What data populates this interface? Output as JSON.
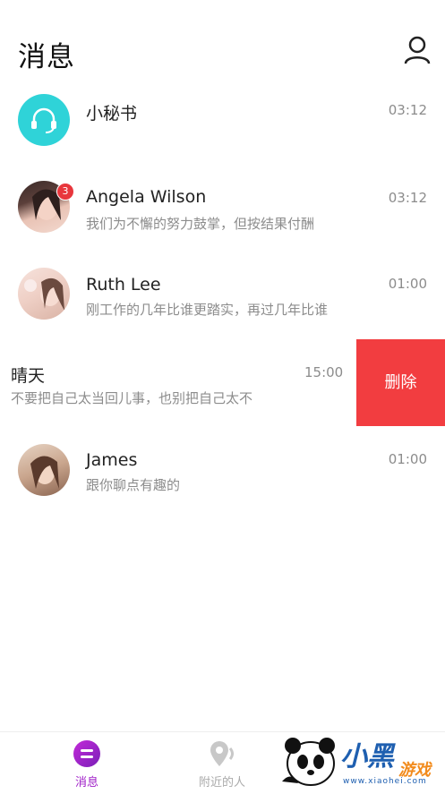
{
  "header": {
    "title": "消息",
    "profile_icon": "user-icon"
  },
  "conversations": [
    {
      "name": "小秘书",
      "preview": "",
      "time": "03:12",
      "avatar": "headset-icon",
      "avatar_color": "#2fd3d8"
    },
    {
      "name": "Angela Wilson",
      "preview": "我们为不懈的努力鼓掌，但按结果付酬",
      "time": "03:12",
      "badge": "3"
    },
    {
      "name": "Ruth Lee",
      "preview": "刚工作的几年比谁更踏实，再过几年比谁",
      "time": "01:00"
    },
    {
      "name": "晴天",
      "preview": "不要把自己太当回儿事，也别把自己太不",
      "time": "15:00",
      "swiped": true
    },
    {
      "name": "James",
      "preview": "跟你聊点有趣的",
      "time": "01:00"
    }
  ],
  "swipe_action": {
    "label": "删除",
    "color": "#f23d40"
  },
  "tabs": [
    {
      "label": "消息",
      "icon": "message-icon",
      "active": true,
      "color": "#a020c8"
    },
    {
      "label": "附近的人",
      "icon": "location-pin-icon",
      "active": false,
      "color": "#aaaaaa"
    }
  ],
  "watermark": {
    "text": "小黑",
    "text2": "游戏",
    "url": "www.xiaohei.com"
  }
}
